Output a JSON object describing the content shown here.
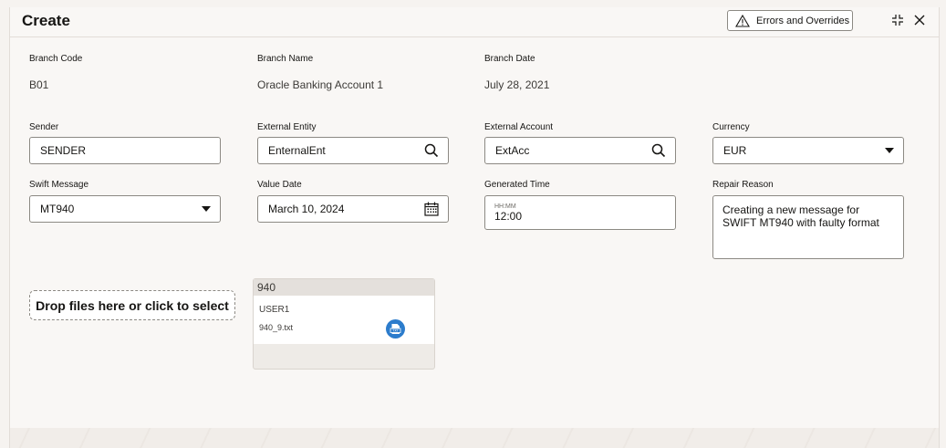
{
  "header": {
    "title": "Create",
    "errors_button": "Errors and Overrides"
  },
  "branch": {
    "code_label": "Branch Code",
    "code_value": "B01",
    "name_label": "Branch Name",
    "name_value": "Oracle Banking Account 1",
    "date_label": "Branch Date",
    "date_value": "July 28, 2021"
  },
  "form": {
    "sender_label": "Sender",
    "sender_value": "SENDER",
    "external_entity_label": "External Entity",
    "external_entity_value": "EnternalEnt",
    "external_account_label": "External Account",
    "external_account_value": "ExtAcc",
    "currency_label": "Currency",
    "currency_value": "EUR",
    "swift_message_label": "Swift Message",
    "swift_message_value": "MT940",
    "value_date_label": "Value Date",
    "value_date_value": "March 10, 2024",
    "generated_time_label": "Generated Time",
    "generated_time_placeholder": "HH:MM",
    "generated_time_value": "12:00",
    "repair_reason_label": "Repair Reason",
    "repair_reason_value": "Creating a new message for SWIFT MT940 with faulty format"
  },
  "upload": {
    "dropzone_text": "Drop files here or click to select",
    "file_card": {
      "header": "940",
      "user": "USER1",
      "filename": "940_9.txt",
      "icon": "txt-file-icon"
    }
  },
  "colors": {
    "border": "#8c8983",
    "background": "#f9f7f5",
    "file_icon": "#2c7ccc"
  }
}
